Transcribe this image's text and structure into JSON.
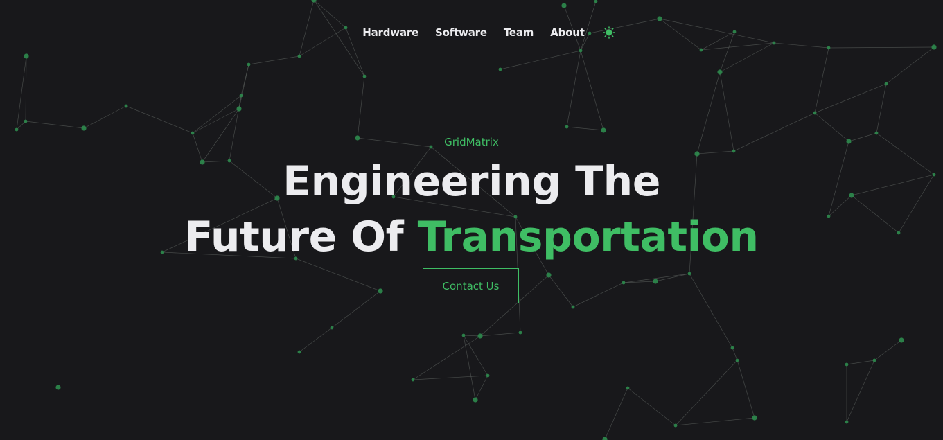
{
  "nav": {
    "items": [
      "Hardware",
      "Software",
      "Team",
      "About"
    ],
    "theme_icon": "sun-icon"
  },
  "hero": {
    "eyebrow": "GridMatrix",
    "headline_line1": "Engineering The",
    "headline_line2_prefix": "Future Of ",
    "headline_line2_accent": "Transportation",
    "cta_label": "Contact Us"
  },
  "colors": {
    "background": "#18181b",
    "text": "#ececef",
    "accent": "#3fbd64",
    "network_line": "#5a5f5c",
    "network_node": "#2e8b4e"
  }
}
